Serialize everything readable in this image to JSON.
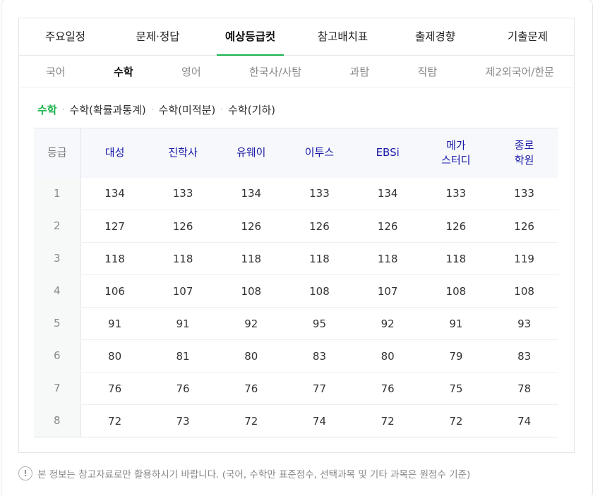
{
  "tabs": [
    {
      "label": "주요일정",
      "active": false
    },
    {
      "label": "문제·정답",
      "active": false
    },
    {
      "label": "예상등급컷",
      "active": true
    },
    {
      "label": "참고배치표",
      "active": false
    },
    {
      "label": "출제경향",
      "active": false
    },
    {
      "label": "기출문제",
      "active": false
    }
  ],
  "subtabs": [
    {
      "label": "국어",
      "active": false
    },
    {
      "label": "수학",
      "active": true
    },
    {
      "label": "영어",
      "active": false
    },
    {
      "label": "한국사/사탐",
      "active": false
    },
    {
      "label": "과탐",
      "active": false
    },
    {
      "label": "직탐",
      "active": false
    },
    {
      "label": "제2외국어/한문",
      "active": false
    }
  ],
  "chips": [
    {
      "label": "수학",
      "active": true
    },
    {
      "label": "수학(확률과통계)",
      "active": false
    },
    {
      "label": "수학(미적분)",
      "active": false
    },
    {
      "label": "수학(기하)",
      "active": false
    }
  ],
  "table": {
    "grade_header": "등급",
    "columns": [
      {
        "line1": "대성",
        "line2": ""
      },
      {
        "line1": "진학사",
        "line2": ""
      },
      {
        "line1": "유웨이",
        "line2": ""
      },
      {
        "line1": "이투스",
        "line2": ""
      },
      {
        "line1": "EBSi",
        "line2": ""
      },
      {
        "line1": "메가",
        "line2": "스터디"
      },
      {
        "line1": "종로",
        "line2": "학원"
      }
    ],
    "rows": [
      {
        "grade": "1",
        "values": [
          "134",
          "133",
          "134",
          "133",
          "134",
          "133",
          "133"
        ]
      },
      {
        "grade": "2",
        "values": [
          "127",
          "126",
          "126",
          "126",
          "126",
          "126",
          "126"
        ]
      },
      {
        "grade": "3",
        "values": [
          "118",
          "118",
          "118",
          "118",
          "118",
          "118",
          "119"
        ]
      },
      {
        "grade": "4",
        "values": [
          "106",
          "107",
          "108",
          "108",
          "107",
          "108",
          "108"
        ]
      },
      {
        "grade": "5",
        "values": [
          "91",
          "91",
          "92",
          "95",
          "92",
          "91",
          "93"
        ]
      },
      {
        "grade": "6",
        "values": [
          "80",
          "81",
          "80",
          "83",
          "80",
          "79",
          "83"
        ]
      },
      {
        "grade": "7",
        "values": [
          "76",
          "76",
          "76",
          "77",
          "76",
          "75",
          "78"
        ]
      },
      {
        "grade": "8",
        "values": [
          "72",
          "73",
          "72",
          "74",
          "72",
          "72",
          "74"
        ]
      }
    ]
  },
  "notice": {
    "icon": "exclamation-icon",
    "icon_glyph": "!",
    "text": "본 정보는 참고자료로만 활용하시기 바랍니다. (국어, 수학만 표준점수, 선택과목 및 기타 과목은 원점수 기준)"
  },
  "colors": {
    "accent": "#19b34c",
    "provider_header": "#1a1aa8"
  }
}
